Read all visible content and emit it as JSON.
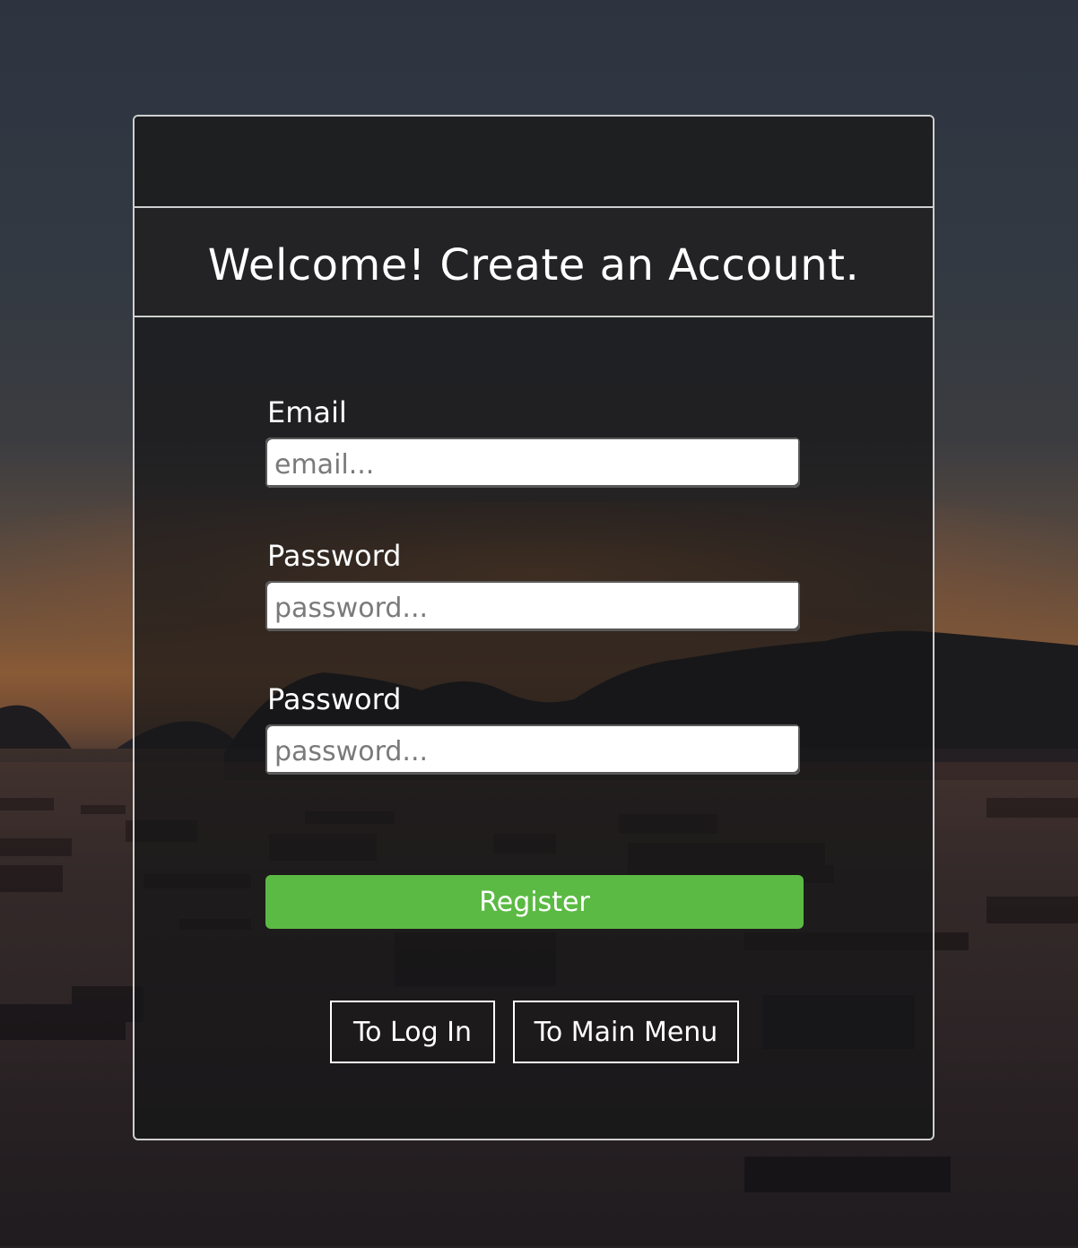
{
  "page": {
    "title": "Welcome! Create an Account."
  },
  "form": {
    "email": {
      "label": "Email",
      "placeholder": "email..."
    },
    "password": {
      "label": "Password",
      "placeholder": "password..."
    },
    "confirm_password": {
      "label": "Password",
      "placeholder": "password..."
    },
    "register_label": "Register"
  },
  "nav": {
    "login_label": "To Log In",
    "main_menu_label": "To Main Menu"
  },
  "colors": {
    "register_button": "#5bba43",
    "card_border": "#cfcfcf",
    "text": "#ffffff"
  }
}
